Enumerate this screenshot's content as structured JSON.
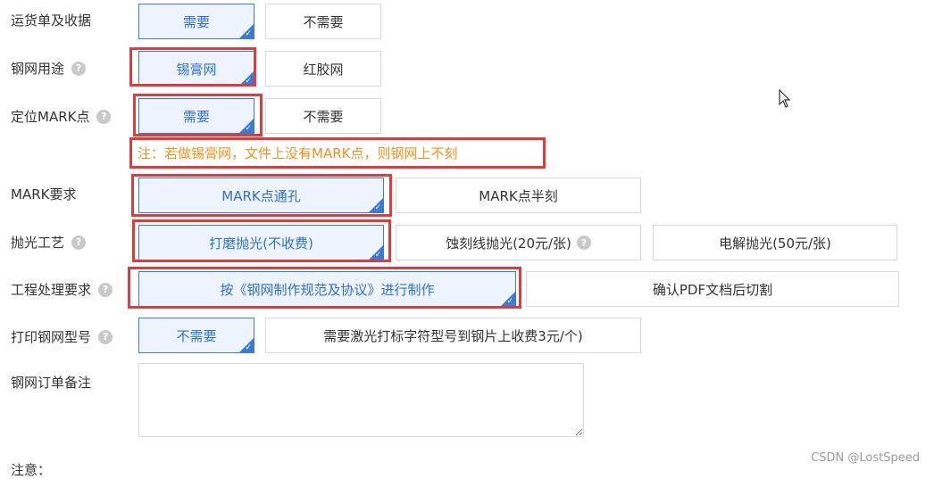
{
  "rows": {
    "delivery": {
      "label": "运货单及收据",
      "options": [
        "需要",
        "不需要"
      ]
    },
    "usage": {
      "label": "钢网用途",
      "options": [
        "锡膏网",
        "红胶网"
      ]
    },
    "mark_pos": {
      "label": "定位MARK点",
      "options": [
        "需要",
        "不需要"
      ]
    },
    "note": "注：若做锡膏网，文件上没有MARK点，则钢网上不刻",
    "mark_req": {
      "label": "MARK要求",
      "options": [
        "MARK点通孔",
        "MARK点半刻"
      ]
    },
    "polish": {
      "label": "抛光工艺",
      "options": [
        "打磨抛光(不收费)",
        "蚀刻线抛光(20元/张)",
        "电解抛光(50元/张)"
      ]
    },
    "process": {
      "label": "工程处理要求",
      "options": [
        "按《钢网制作规范及协议》进行制作",
        "确认PDF文档后切割"
      ]
    },
    "print_model": {
      "label": "打印钢网型号",
      "options": [
        "不需要",
        "需要激光打标字符型号到钢片上收费3元/个)"
      ]
    },
    "remark": {
      "label": "钢网订单备注",
      "value": ""
    },
    "footer_label": "注意："
  },
  "help_icon": "?",
  "watermark": "CSDN @LostSpeed",
  "colors": {
    "selected_border": "#3a7bd5",
    "selected_text": "#2f6fd0",
    "highlight": "#e03a3a",
    "note": "#f0901e"
  }
}
